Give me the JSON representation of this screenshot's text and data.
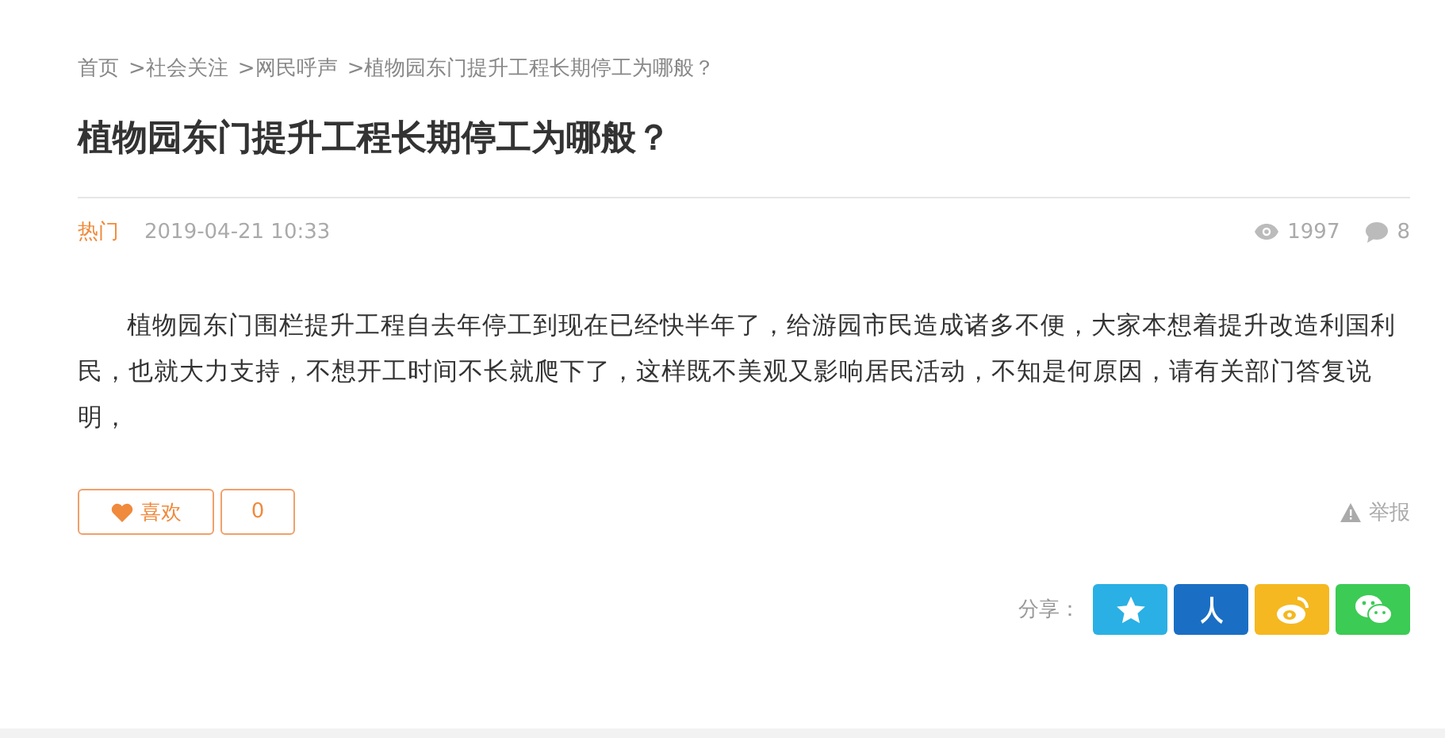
{
  "breadcrumb": [
    {
      "label": "首页"
    },
    {
      "label": ">社会关注"
    },
    {
      "label": ">网民呼声"
    },
    {
      "label": ">植物园东门提升工程长期停工为哪般？"
    }
  ],
  "title": "植物园东门提升工程长期停工为哪般？",
  "meta": {
    "tag": "热门",
    "date": "2019-04-21 10:33",
    "views": "1997",
    "comments": "8"
  },
  "body": "植物园东门围栏提升工程自去年停工到现在已经快半年了，给游园市民造成诸多不便，大家本想着提升改造利国利民，也就大力支持，不想开工时间不长就爬下了，这样既不美观又影响居民活动，不知是何原因，请有关部门答复说明，",
  "like": {
    "label": "喜欢",
    "count": "0"
  },
  "report": "举报",
  "share": {
    "label": "分享：",
    "targets": [
      {
        "kind": "qzone",
        "color": "#2ab0e4"
      },
      {
        "kind": "renren",
        "color": "#1a6fc4"
      },
      {
        "kind": "weibo",
        "color": "#f5b820"
      },
      {
        "kind": "wechat",
        "color": "#3ccb55"
      }
    ]
  }
}
